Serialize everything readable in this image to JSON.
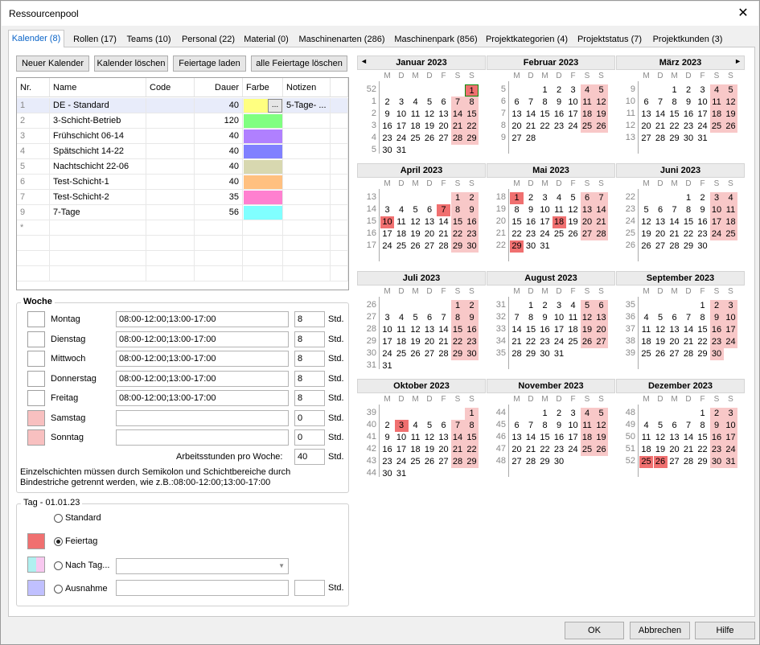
{
  "window": {
    "title": "Ressourcenpool",
    "close": "✕"
  },
  "tabs": [
    "Kalender (8)",
    "Rollen (17)",
    "Teams (10)",
    "Personal (22)",
    "Material (0)",
    "Maschinenarten (286)",
    "Maschinenpark (856)",
    "Projektkategorien (4)",
    "Projektstatus (7)",
    "Projektkunden (3)"
  ],
  "toolbar": {
    "new": "Neuer Kalender",
    "delete": "Kalender löschen",
    "load": "Feiertage laden",
    "deleteall": "alle Feiertage löschen"
  },
  "grid": {
    "headers": [
      "Nr.",
      "Name",
      "Code",
      "Dauer",
      "Farbe",
      "Notizen"
    ],
    "rows": [
      {
        "nr": "1",
        "name": "DE - Standard",
        "code": "",
        "dauer": "40",
        "color": "#ffff80",
        "notes": "5-Tage- ...",
        "dots": "..."
      },
      {
        "nr": "2",
        "name": "3-Schicht-Betrieb",
        "code": "",
        "dauer": "120",
        "color": "#80ff80",
        "notes": ""
      },
      {
        "nr": "3",
        "name": "Frühschicht 06-14",
        "code": "",
        "dauer": "40",
        "color": "#b080ff",
        "notes": ""
      },
      {
        "nr": "4",
        "name": "Spätschicht 14-22",
        "code": "",
        "dauer": "40",
        "color": "#8080ff",
        "notes": ""
      },
      {
        "nr": "5",
        "name": "Nachtschicht 22-06",
        "code": "",
        "dauer": "40",
        "color": "#d8d8b0",
        "notes": ""
      },
      {
        "nr": "6",
        "name": "Test-Schicht-1",
        "code": "",
        "dauer": "40",
        "color": "#ffc080",
        "notes": ""
      },
      {
        "nr": "7",
        "name": "Test-Schicht-2",
        "code": "",
        "dauer": "35",
        "color": "#ff80d0",
        "notes": ""
      },
      {
        "nr": "9",
        "name": "7-Tage",
        "code": "",
        "dauer": "56",
        "color": "#80ffff",
        "notes": ""
      }
    ],
    "newrow": "*"
  },
  "woche": {
    "label": "Woche",
    "days": [
      {
        "name": "Montag",
        "times": "08:00-12:00;13:00-17:00",
        "hours": "8",
        "weekend": false
      },
      {
        "name": "Dienstag",
        "times": "08:00-12:00;13:00-17:00",
        "hours": "8",
        "weekend": false
      },
      {
        "name": "Mittwoch",
        "times": "08:00-12:00;13:00-17:00",
        "hours": "8",
        "weekend": false
      },
      {
        "name": "Donnerstag",
        "times": "08:00-12:00;13:00-17:00",
        "hours": "8",
        "weekend": false
      },
      {
        "name": "Freitag",
        "times": "08:00-12:00;13:00-17:00",
        "hours": "8",
        "weekend": false
      },
      {
        "name": "Samstag",
        "times": "",
        "hours": "0",
        "weekend": true
      },
      {
        "name": "Sonntag",
        "times": "",
        "hours": "0",
        "weekend": true
      }
    ],
    "unit": "Std.",
    "total_label": "Arbeitsstunden pro Woche:",
    "total": "40",
    "hint": "Einzelschichten müssen durch Semikolon und Schichtbereiche durch Bindestriche getrennt werden, wie z.B.:08:00-12:00;13:00-17:00"
  },
  "tag": {
    "label": "Tag - 01.01.23",
    "standard": "Standard",
    "feiertag": "Feiertag",
    "nachtag": "Nach Tag...",
    "ausnahme": "Ausnahme",
    "unit": "Std.",
    "selected": "feiertag"
  },
  "calendar": {
    "weekday_headers": [
      "M",
      "D",
      "M",
      "D",
      "F",
      "S",
      "S"
    ],
    "months": [
      {
        "name": "Januar 2023",
        "start": 6,
        "days": 31,
        "firstweek": 52,
        "holidays": [
          1
        ],
        "today": 1
      },
      {
        "name": "Februar 2023",
        "start": 2,
        "days": 28,
        "firstweek": 5,
        "holidays": []
      },
      {
        "name": "März 2023",
        "start": 2,
        "days": 31,
        "firstweek": 9,
        "holidays": []
      },
      {
        "name": "April 2023",
        "start": 5,
        "days": 30,
        "firstweek": 13,
        "holidays": [
          7,
          10
        ]
      },
      {
        "name": "Mai 2023",
        "start": 0,
        "days": 31,
        "firstweek": 18,
        "holidays": [
          1,
          18,
          29
        ]
      },
      {
        "name": "Juni 2023",
        "start": 3,
        "days": 30,
        "firstweek": 22,
        "holidays": []
      },
      {
        "name": "Juli 2023",
        "start": 5,
        "days": 31,
        "firstweek": 26,
        "holidays": []
      },
      {
        "name": "August 2023",
        "start": 1,
        "days": 31,
        "firstweek": 31,
        "holidays": []
      },
      {
        "name": "September 2023",
        "start": 4,
        "days": 30,
        "firstweek": 35,
        "holidays": []
      },
      {
        "name": "Oktober 2023",
        "start": 6,
        "days": 31,
        "firstweek": 39,
        "holidays": [
          3
        ]
      },
      {
        "name": "November 2023",
        "start": 2,
        "days": 30,
        "firstweek": 44,
        "holidays": []
      },
      {
        "name": "Dezember 2023",
        "start": 4,
        "days": 31,
        "firstweek": 48,
        "holidays": [
          25,
          26
        ]
      }
    ],
    "prev": "◄",
    "next": "►"
  },
  "footer": {
    "ok": "OK",
    "cancel": "Abbrechen",
    "help": "Hilfe"
  }
}
